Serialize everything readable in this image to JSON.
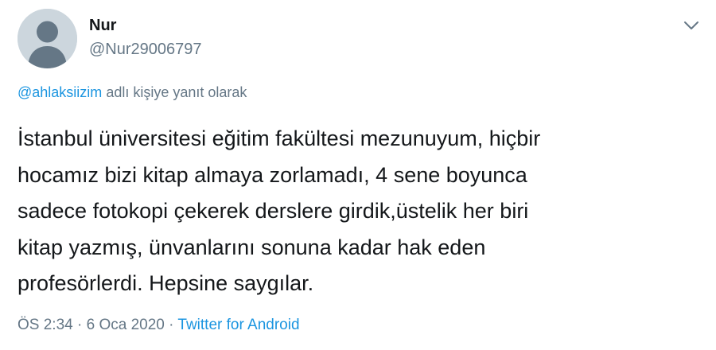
{
  "author": {
    "display_name": "Nur",
    "handle": "@Nur29006797",
    "avatar_icon": "default-profile-icon"
  },
  "menu": {
    "icon": "chevron-down-icon"
  },
  "reply_context": {
    "mention": "@ahlaksiizim",
    "suffix": "adlı kişiye yanıt olarak"
  },
  "tweet": {
    "lines": [
      "İstanbul üniversitesi eğitim fakültesi mezunuyum, hiçbir",
      "hocamız bizi kitap almaya zorlamadı, 4 sene boyunca",
      "sadece fotokopi çekerek derslere girdik,üstelik her biri",
      "kitap yazmış, ünvanlarını sonuna kadar hak eden",
      "profesörlerdi. Hepsine saygılar."
    ]
  },
  "meta": {
    "time": "ÖS 2:34",
    "separator1": "·",
    "date": "6 Oca 2020",
    "separator2": "·",
    "source": "Twitter for Android"
  },
  "colors": {
    "link": "#1b95e0",
    "secondary_text": "#657786",
    "primary_text": "#14171a",
    "avatar_bg": "#ccd6dd",
    "avatar_fg": "#657786"
  }
}
